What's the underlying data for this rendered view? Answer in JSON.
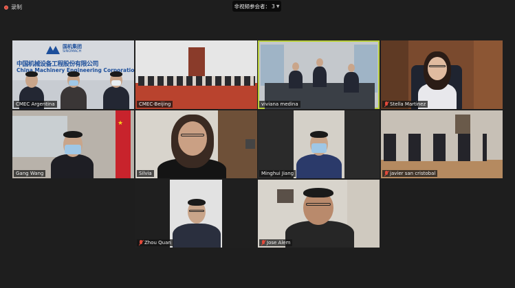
{
  "toolbar": {
    "recording_label": "录制",
    "participants_label": "非视频参会者：",
    "participants_count": "3"
  },
  "tiles": [
    {
      "name": "CMEC Argentina",
      "muted": false
    },
    {
      "name": "CMEC-Beijing",
      "muted": false
    },
    {
      "name": "viviana medina",
      "muted": false,
      "active": true
    },
    {
      "name": "Stella Martinez",
      "muted": true
    },
    {
      "name": "Gang Wang",
      "muted": false
    },
    {
      "name": "Silvia",
      "muted": false
    },
    {
      "name": "Minghui Jiang",
      "muted": false
    },
    {
      "name": "javier san cristobal",
      "muted": true
    },
    {
      "name": "Zhou Quan",
      "muted": true
    },
    {
      "name": "Jose Alem",
      "muted": true
    }
  ],
  "backdrop": {
    "logo_text": "国机集团",
    "logo_sub": "SINOMACH",
    "company_cn": "中国机械设备工程股份有限公司",
    "company_en": "China Machinery Engineering Corporation"
  },
  "colors": {
    "active_speaker_border": "#b9cf3a",
    "muted_icon": "#e24a3b",
    "recording_dot": "#e0473a"
  }
}
